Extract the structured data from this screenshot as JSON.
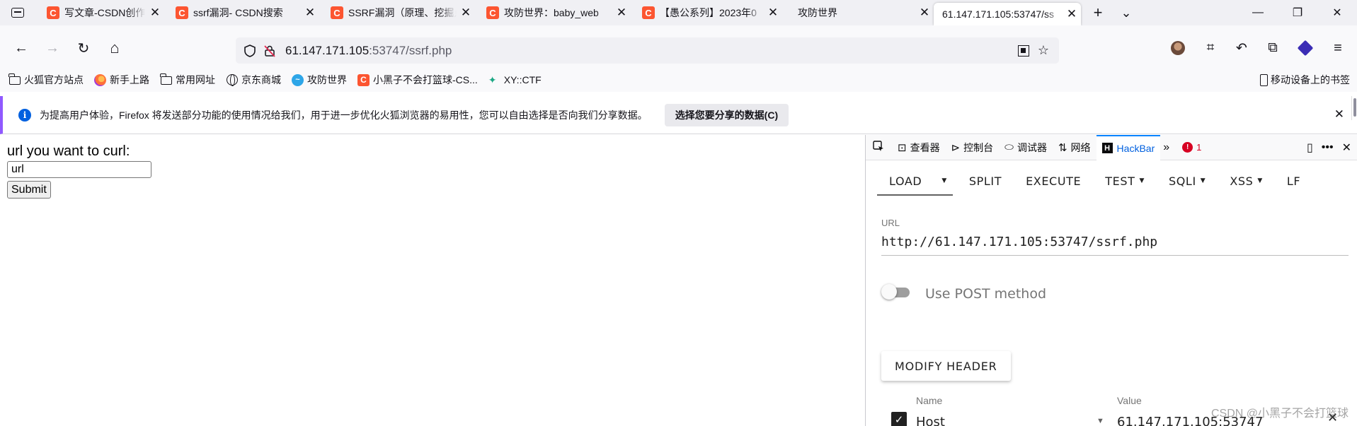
{
  "tabs": [
    {
      "title": "写文章-CSDN创作中心",
      "favicon": "C",
      "selected": false
    },
    {
      "title": "ssrf漏洞- CSDN搜索",
      "favicon": "C",
      "selected": false
    },
    {
      "title": "SSRF漏洞（原理、挖掘点",
      "favicon": "C",
      "selected": false
    },
    {
      "title": "攻防世界：baby_web",
      "favicon": "C",
      "selected": false
    },
    {
      "title": "【愚公系列】2023年0",
      "favicon": "C",
      "selected": false
    },
    {
      "title": "攻防世界",
      "favicon": "",
      "selected": false
    },
    {
      "title": "61.147.171.105:53747/ss",
      "favicon": "",
      "selected": true
    }
  ],
  "tabstrip": {
    "new_tab": "+",
    "list_all": "⌄",
    "minimize": "—",
    "restore": "❐",
    "close": "✕"
  },
  "nav": {
    "url_host": "61.147.171.105",
    "url_rest": ":53747/ssrf.php",
    "back": "←",
    "forward": "→",
    "reload": "↻",
    "home": "⌂"
  },
  "bookmarks": [
    {
      "label": "火狐官方站点",
      "icon": "folder-icon"
    },
    {
      "label": "新手上路",
      "icon": "firefox-icon"
    },
    {
      "label": "常用网址",
      "icon": "folder-icon"
    },
    {
      "label": "京东商城",
      "icon": "globe-icon"
    },
    {
      "label": "攻防世界",
      "icon": "adworld-icon"
    },
    {
      "label": "小黑子不会打篮球-CS...",
      "icon": "csdn-icon"
    },
    {
      "label": "XY::CTF",
      "icon": "xyctf-icon"
    }
  ],
  "mobile_bookmarks": "移动设备上的书签",
  "notification": {
    "text": "为提高用户体验，Firefox 将发送部分功能的使用情况给我们，用于进一步优化火狐浏览器的易用性，您可以自由选择是否向我们分享数据。",
    "button": "选择您要分享的数据(C)"
  },
  "page": {
    "label": "url you want to curl:",
    "input_value": "url",
    "submit": "Submit"
  },
  "devtools": {
    "tools": {
      "inspector": "查看器",
      "console": "控制台",
      "debugger": "调试器",
      "network": "网络",
      "hackbar": "HackBar"
    },
    "error_count": "1"
  },
  "hackbar": {
    "menu": {
      "load": "LOAD",
      "split": "SPLIT",
      "execute": "EXECUTE",
      "test": "TEST",
      "sqli": "SQLI",
      "xss": "XSS",
      "more": "LF"
    },
    "url_label": "URL",
    "url_value": "http://61.147.171.105:53747/ssrf.php",
    "post_label": "Use POST method",
    "modify_header": "MODIFY HEADER",
    "header_name_label": "Name",
    "header_value_label": "Value",
    "header_name": "Host",
    "header_value": "61.147.171.105:53747"
  },
  "watermark": "CSDN @小黑子不会打篮球",
  "colors": {
    "accent": "#0060df",
    "csdn": "#fc5531",
    "notify_border": "#9059ff"
  }
}
